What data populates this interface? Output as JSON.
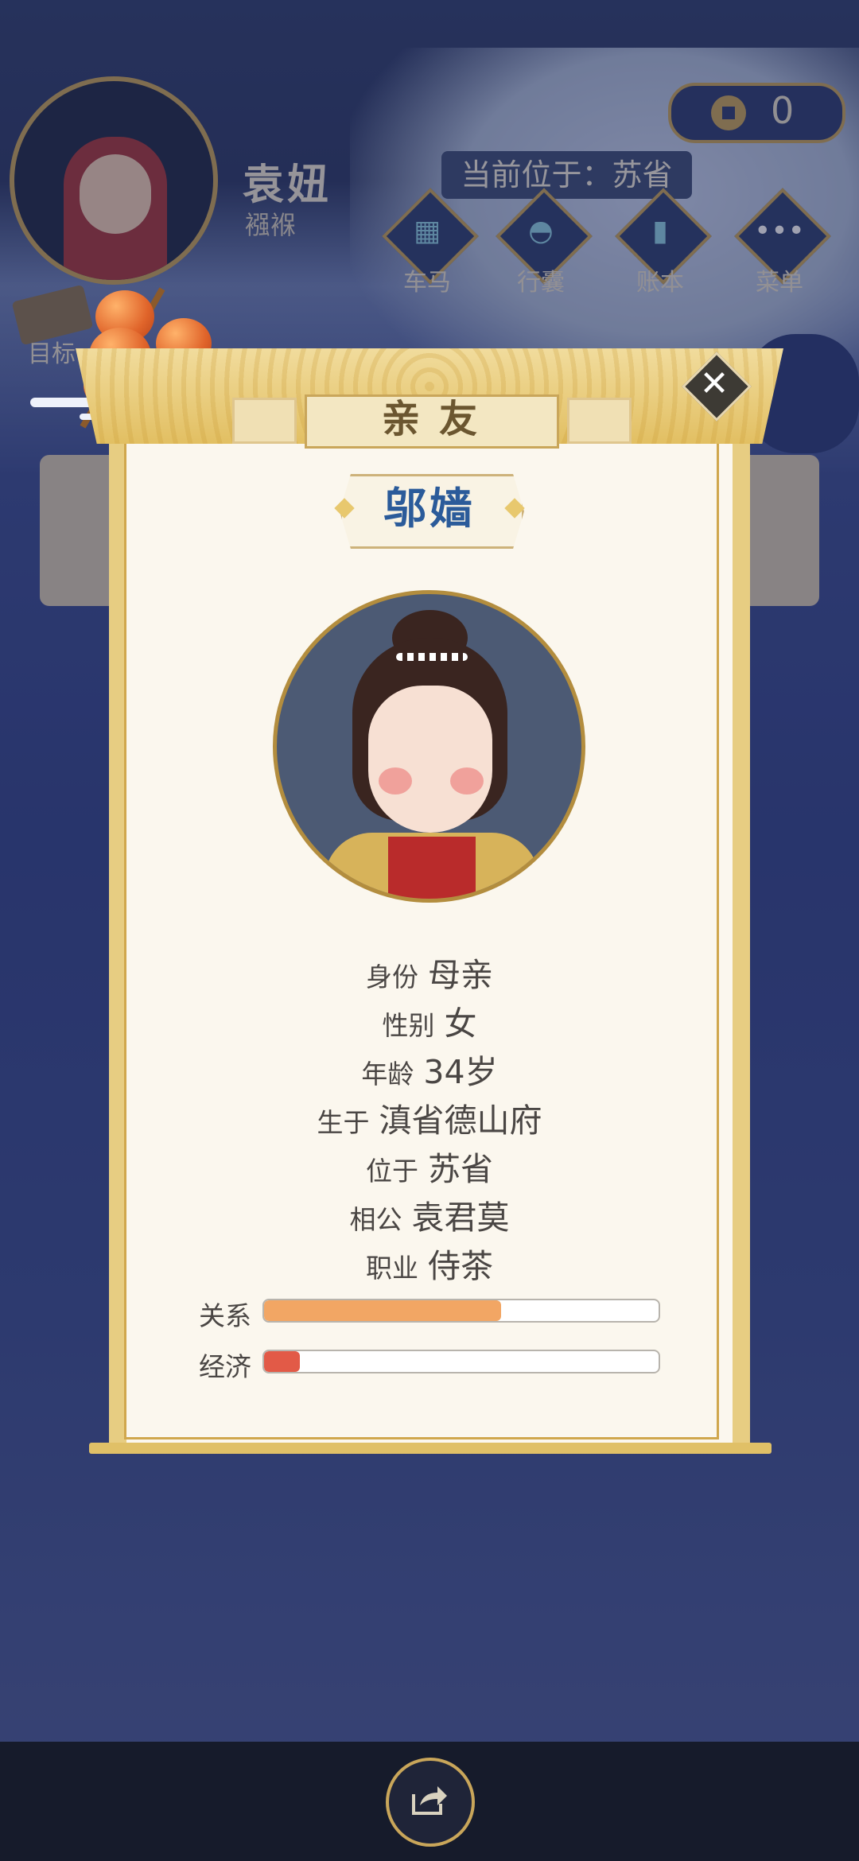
{
  "player": {
    "name": "袁妞",
    "status": "襁褓"
  },
  "location": {
    "label": "当前位于：",
    "place": "苏省"
  },
  "currency": {
    "amount": "0"
  },
  "nav": [
    {
      "label": "车马",
      "icon": "carriage-icon"
    },
    {
      "label": "行囊",
      "icon": "bag-icon"
    },
    {
      "label": "账本",
      "icon": "ledger-icon"
    },
    {
      "label": "菜单",
      "icon": "more-icon"
    }
  ],
  "goal": {
    "label": "目标"
  },
  "modal": {
    "title": "亲友",
    "name": "邬嫱",
    "rows": [
      {
        "key": "身份",
        "value": "母亲"
      },
      {
        "key": "性别",
        "value": "女"
      },
      {
        "key": "年龄",
        "value": "34岁"
      },
      {
        "key": "生于",
        "value": "滇省德山府"
      },
      {
        "key": "位于",
        "value": "苏省"
      },
      {
        "key": "相公",
        "value": "袁君莫"
      },
      {
        "key": "职业",
        "value": "侍茶"
      }
    ],
    "bars": [
      {
        "label": "关系",
        "fraction": 0.6,
        "color": "#f2a664"
      },
      {
        "label": "经济",
        "fraction": 0.09,
        "color": "#e25a47"
      }
    ]
  },
  "colors": {
    "gold": "#c9a65a",
    "name_blue": "#2b5b9a",
    "scroll_bg": "#fbf7ee"
  }
}
